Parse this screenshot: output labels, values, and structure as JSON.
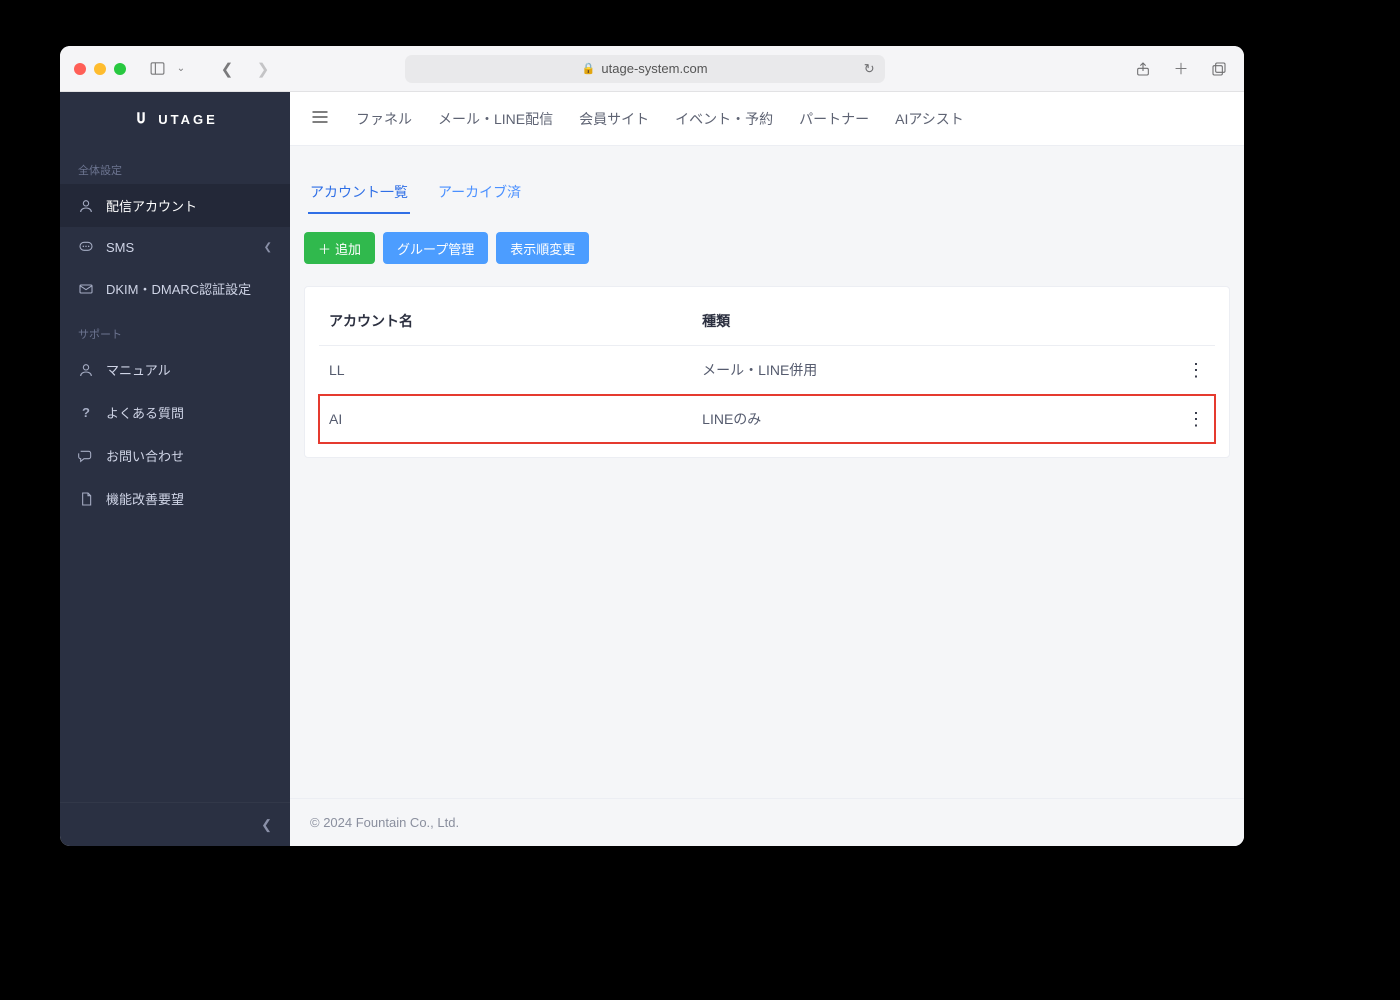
{
  "browser": {
    "url_host": "utage-system.com"
  },
  "brand": {
    "name": "UTAGE"
  },
  "sidebar": {
    "group1_label": "全体設定",
    "items1": [
      {
        "label": "配信アカウント"
      },
      {
        "label": "SMS"
      },
      {
        "label": "DKIM・DMARC認証設定"
      }
    ],
    "group2_label": "サポート",
    "items2": [
      {
        "label": "マニュアル"
      },
      {
        "label": "よくある質問"
      },
      {
        "label": "お問い合わせ"
      },
      {
        "label": "機能改善要望"
      }
    ]
  },
  "topnav": {
    "items": [
      {
        "label": "ファネル"
      },
      {
        "label": "メール・LINE配信"
      },
      {
        "label": "会員サイト"
      },
      {
        "label": "イベント・予約"
      },
      {
        "label": "パートナー"
      },
      {
        "label": "AIアシスト"
      }
    ]
  },
  "tabs": {
    "active": "アカウント一覧",
    "inactive": "アーカイブ済"
  },
  "buttons": {
    "add": "追加",
    "group_manage": "グループ管理",
    "reorder": "表示順変更"
  },
  "table": {
    "col_name": "アカウント名",
    "col_type": "種類",
    "rows": [
      {
        "name": "LL",
        "type": "メール・LINE併用"
      },
      {
        "name": "AI",
        "type": "LINEのみ"
      }
    ]
  },
  "footer": {
    "copyright": "© 2024 Fountain Co., Ltd."
  }
}
